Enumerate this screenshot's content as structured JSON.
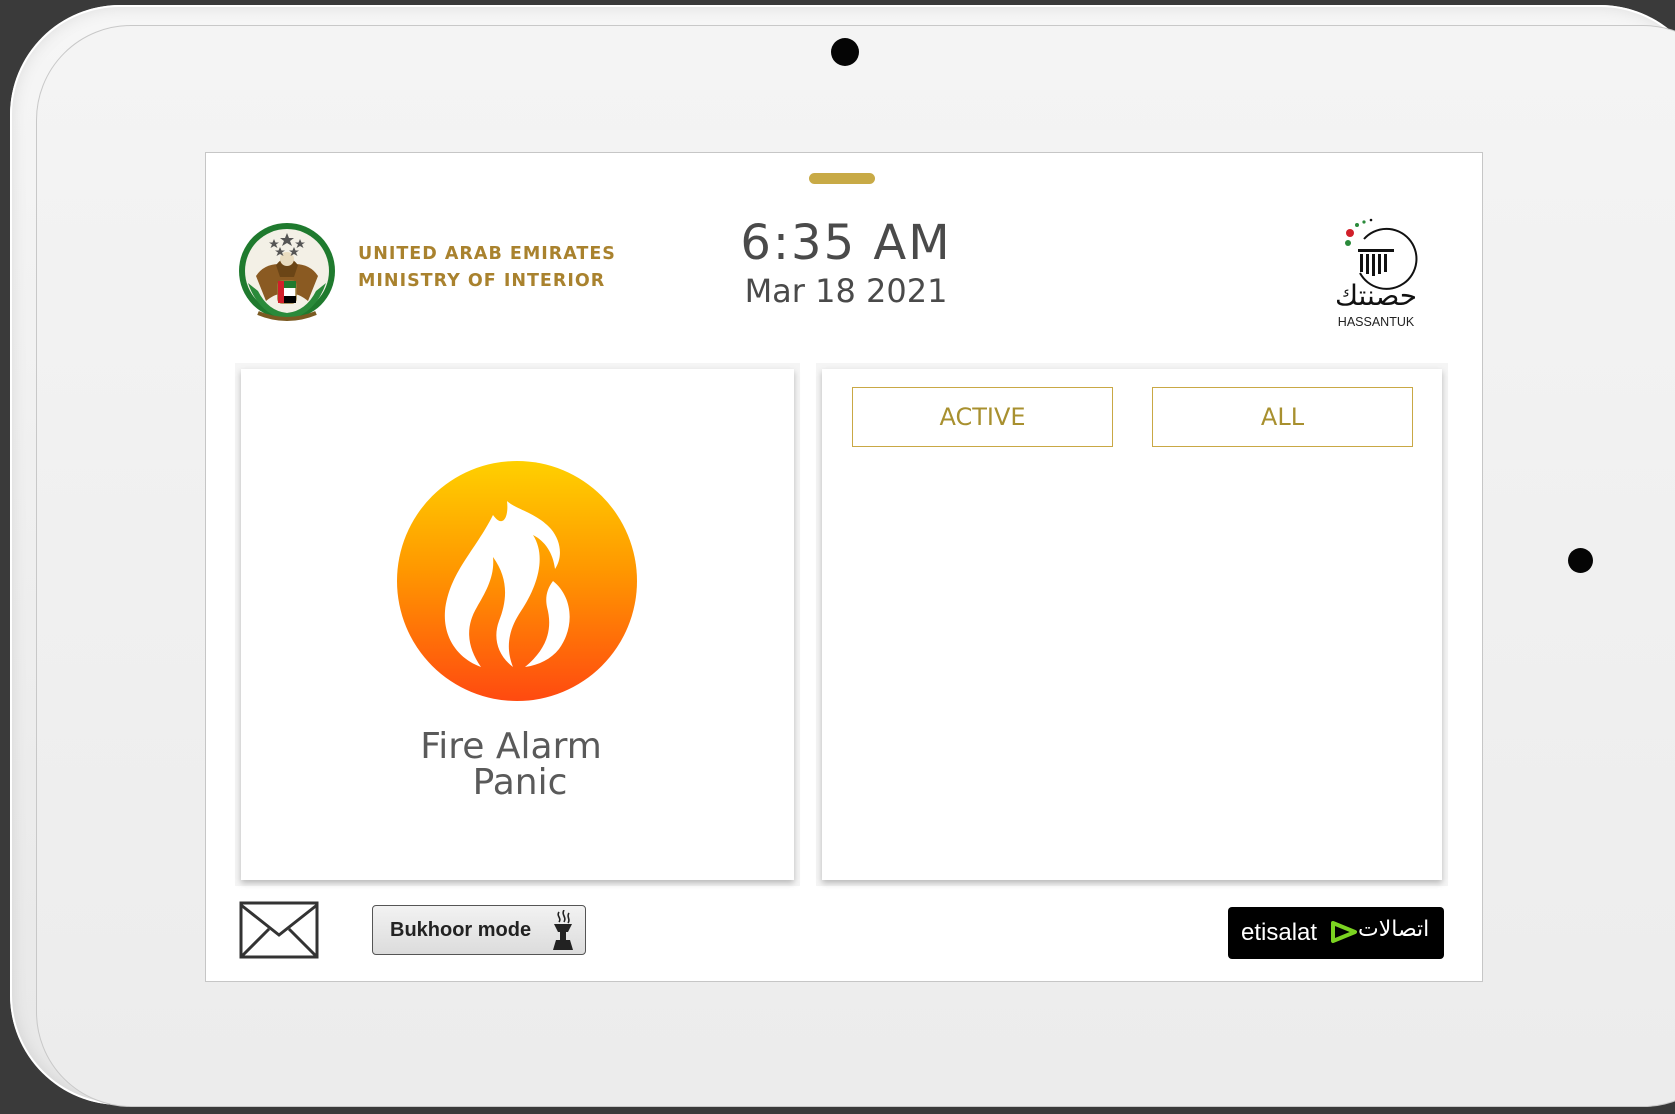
{
  "header": {
    "org_line1": "UNITED ARAB EMIRATES",
    "org_line2": "MINISTRY OF INTERIOR",
    "time": "6:35 AM",
    "date": "Mar 18 2021",
    "brand_logo_text": "HASSANTUK",
    "brand_logo_arabic": "حصنتك"
  },
  "left_panel": {
    "alarm_icon": "fire-icon",
    "alarm_line1": "Fire Alarm",
    "alarm_line2": "Panic"
  },
  "right_panel": {
    "filters": [
      {
        "label": "ACTIVE"
      },
      {
        "label": "ALL"
      }
    ]
  },
  "footer": {
    "messages_icon": "envelope-icon",
    "bukhoor_label": "Bukhoor mode",
    "bukhoor_icon": "incense-burner-icon",
    "partner_latin": "etisalat",
    "partner_arabic": "اتصالات"
  },
  "colors": {
    "accent_gold": "#c8aa46",
    "text_gold": "#a9822e",
    "flame_top": "#ffd000",
    "flame_bottom": "#ff4a10"
  }
}
